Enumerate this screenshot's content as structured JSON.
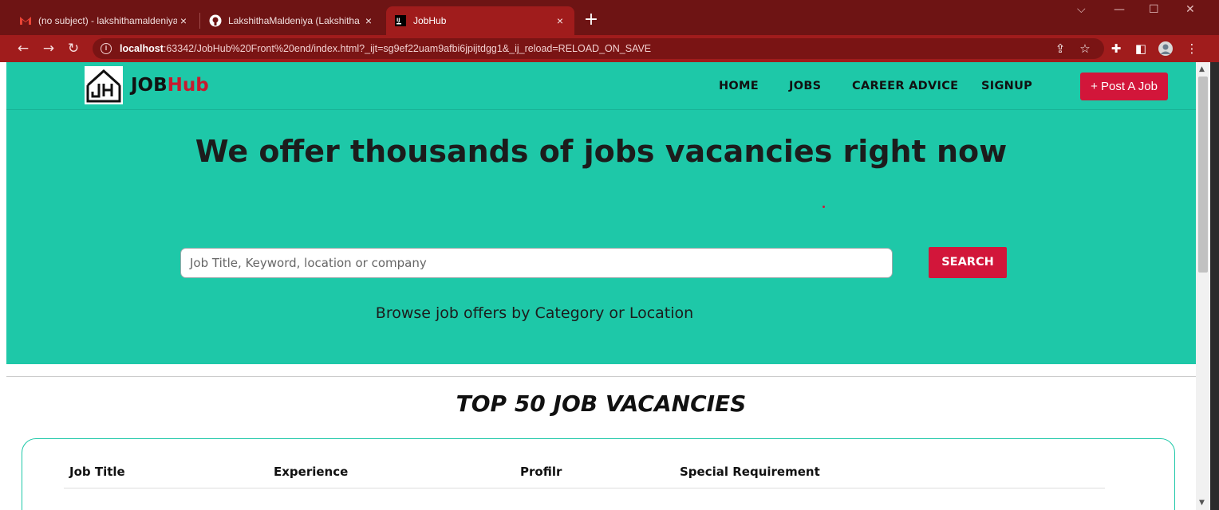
{
  "browser": {
    "tabs": [
      {
        "title": "(no subject) - lakshithamaldeniya",
        "icon": "gmail-icon"
      },
      {
        "title": "LakshithaMaldeniya (Lakshitha M",
        "icon": "github-icon"
      },
      {
        "title": "JobHub",
        "icon": "intellij-icon",
        "active": true
      }
    ],
    "new_tab": "+",
    "url_host": "localhost",
    "url_rest": ":63342/JobHub%20Front%20end/index.html?_ijt=sg9ef22uam9afbi6jpijtdgg1&_ij_reload=RELOAD_ON_SAVE"
  },
  "site": {
    "brand_prefix": "JOB",
    "brand_suffix": "Hub",
    "nav": [
      "HOME",
      "JOBS",
      "CAREER ADVICE",
      "SIGNUP"
    ],
    "post_button": "+ Post A Job",
    "hero_title": "We offer thousands of jobs vacancies right now",
    "search_placeholder": "Job Title, Keyword, location or company",
    "search_button": "SEARCH",
    "browse_text": "Browse job offers by Category or Location",
    "section_title": "TOP 50 JOB VACANCIES",
    "table_headers": [
      "Job Title",
      "Experience",
      "Profilr",
      "Special Requirement"
    ]
  },
  "colors": {
    "brand_teal": "#1ec8a8",
    "accent_red": "#d2163a",
    "browser_frame": "#a01c1c"
  }
}
